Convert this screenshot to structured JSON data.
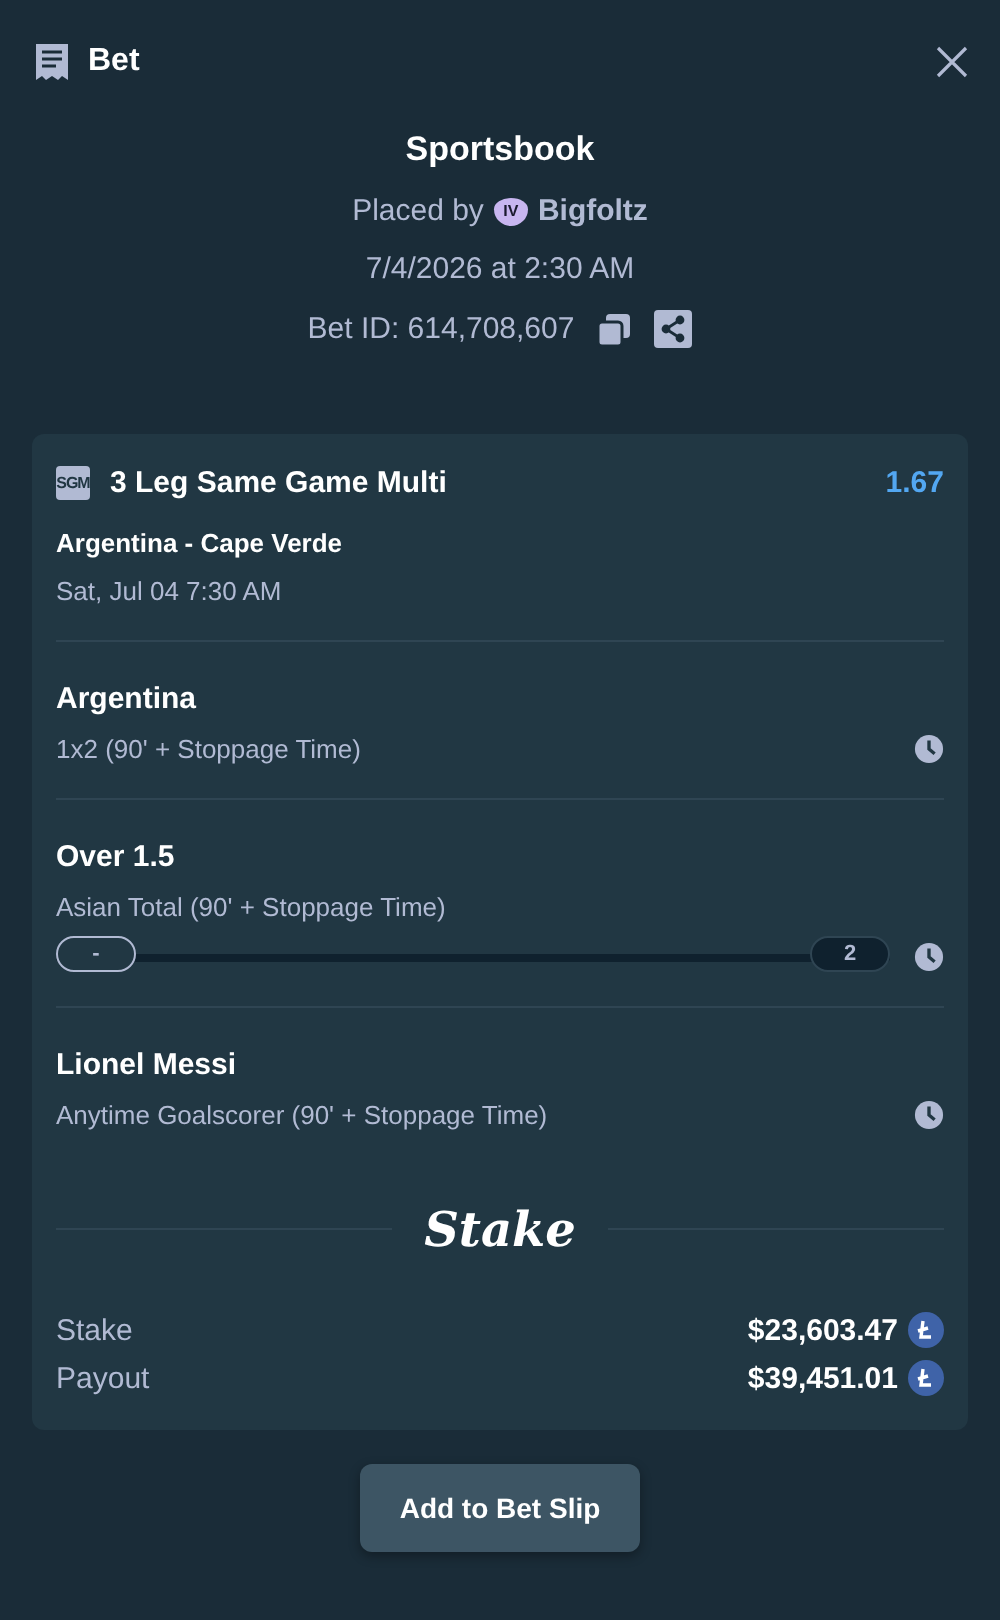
{
  "header": {
    "title": "Bet"
  },
  "summary": {
    "title": "Sportsbook",
    "placed_by": "Placed by",
    "rank_badge": "IV",
    "user": "Bigfoltz",
    "date": "7/4/2026 at 2:30 AM",
    "bet_id": "Bet ID: 614,708,607"
  },
  "bet": {
    "badge": "SGM",
    "name": "3 Leg Same Game Multi",
    "odds": "1.67",
    "event": "Argentina - Cape Verde",
    "event_time": "Sat, Jul 04 7:30 AM",
    "legs": [
      {
        "kind": "plain",
        "selection": "Argentina",
        "market": "1x2 (90' + Stoppage Time)"
      },
      {
        "kind": "progress",
        "selection": "Over 1.5",
        "market": "Asian Total (90' + Stoppage Time)",
        "current": "-",
        "target": "2",
        "level": 0
      },
      {
        "kind": "plain",
        "selection": "Lionel Messi",
        "market": "Anytime Goalscorer (90' + Stoppage Time)"
      }
    ],
    "logo": "Stake",
    "amounts": [
      {
        "label": "Stake",
        "value": "$23,603.47"
      },
      {
        "label": "Payout",
        "value": "$39,451.01"
      }
    ]
  },
  "button": "Add to Bet Slip"
}
